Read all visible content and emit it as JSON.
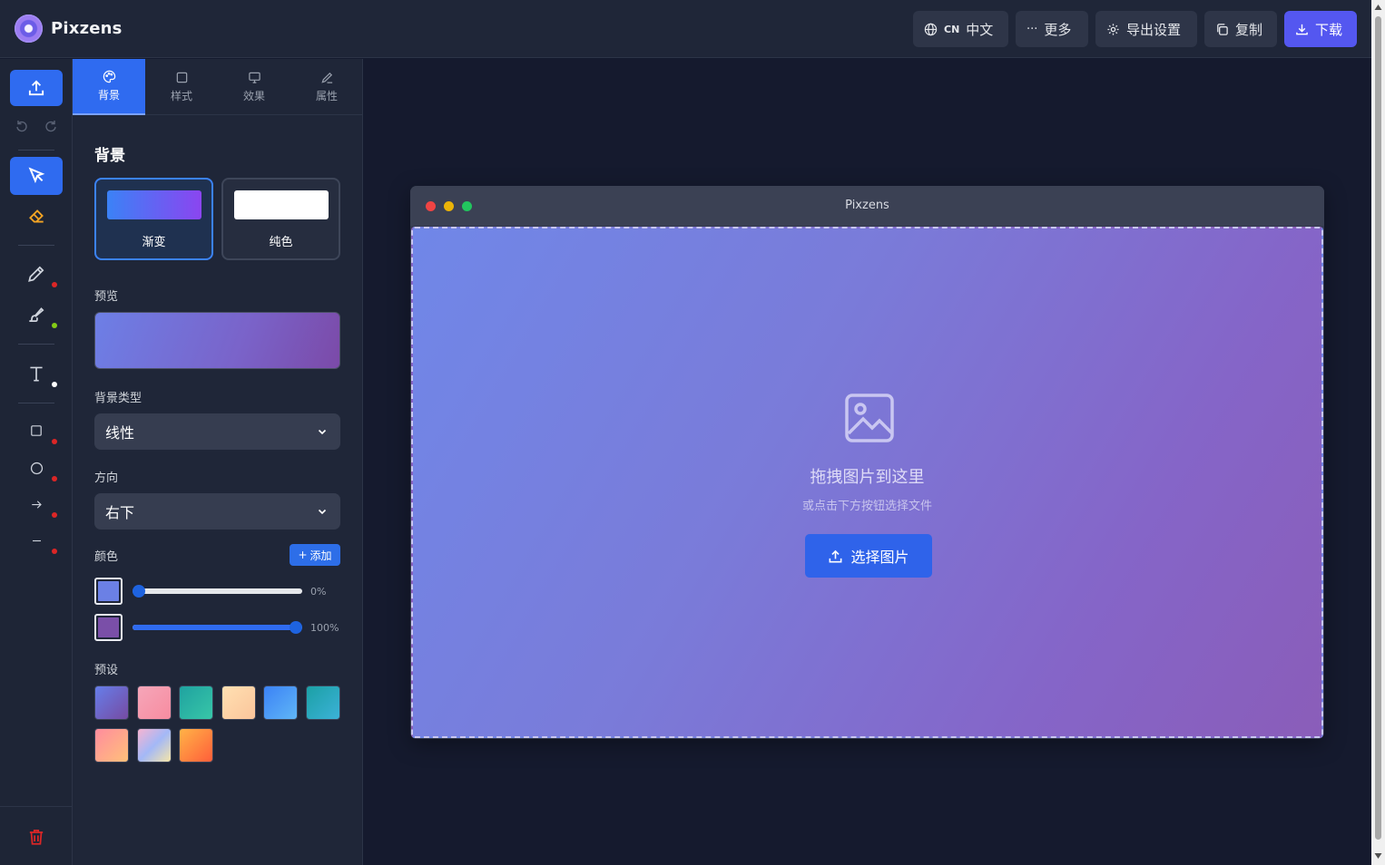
{
  "app": {
    "name": "Pixzens"
  },
  "topbar": {
    "language_code": "CN",
    "language_label": "中文",
    "more_label": "更多",
    "export_settings_label": "导出设置",
    "copy_label": "复制",
    "download_label": "下载"
  },
  "colors": {
    "accent": "#2f6bf0",
    "primary_button": "#5457f0"
  },
  "tabs": [
    {
      "label": "背景",
      "icon": "palette-icon",
      "active": true
    },
    {
      "label": "样式",
      "icon": "square-icon",
      "active": false
    },
    {
      "label": "效果",
      "icon": "monitor-icon",
      "active": false
    },
    {
      "label": "属性",
      "icon": "pencil-icon",
      "active": false
    }
  ],
  "background": {
    "section_title": "背景",
    "type_options": [
      {
        "label": "渐变",
        "active": true
      },
      {
        "label": "纯色",
        "active": false
      }
    ],
    "preview_label": "预览",
    "bg_type_label": "背景类型",
    "bg_type_value": "线性",
    "direction_label": "方向",
    "direction_value": "右下",
    "color_label": "颜色",
    "add_label": "添加",
    "stops": [
      {
        "color": "#6b80e5",
        "position": 0,
        "label": "0%"
      },
      {
        "color": "#7a4fa8",
        "position": 100,
        "label": "100%"
      }
    ],
    "presets_label": "预设",
    "presets": [
      "linear-gradient(135deg,#667eea,#764ba2)",
      "linear-gradient(135deg,#f6a6b9,#f78ca0)",
      "linear-gradient(135deg,#1fa2a0,#38c6a8)",
      "linear-gradient(135deg,#ffe0b2,#fbc59b)",
      "linear-gradient(135deg,#3b82f6,#60b6f6)",
      "linear-gradient(135deg,#1ba0a5,#3cb2d8)",
      "linear-gradient(135deg,#ff8c9e,#ffc07a)",
      "linear-gradient(135deg,#f7b4d1,#a3b8f7,#f6e6a8)",
      "linear-gradient(135deg,#ffb347,#ff5e3a)"
    ]
  },
  "canvas": {
    "window_title": "Pixzens",
    "drop_title": "拖拽图片到这里",
    "drop_subtitle": "或点击下方按钮选择文件",
    "choose_button": "选择图片"
  }
}
